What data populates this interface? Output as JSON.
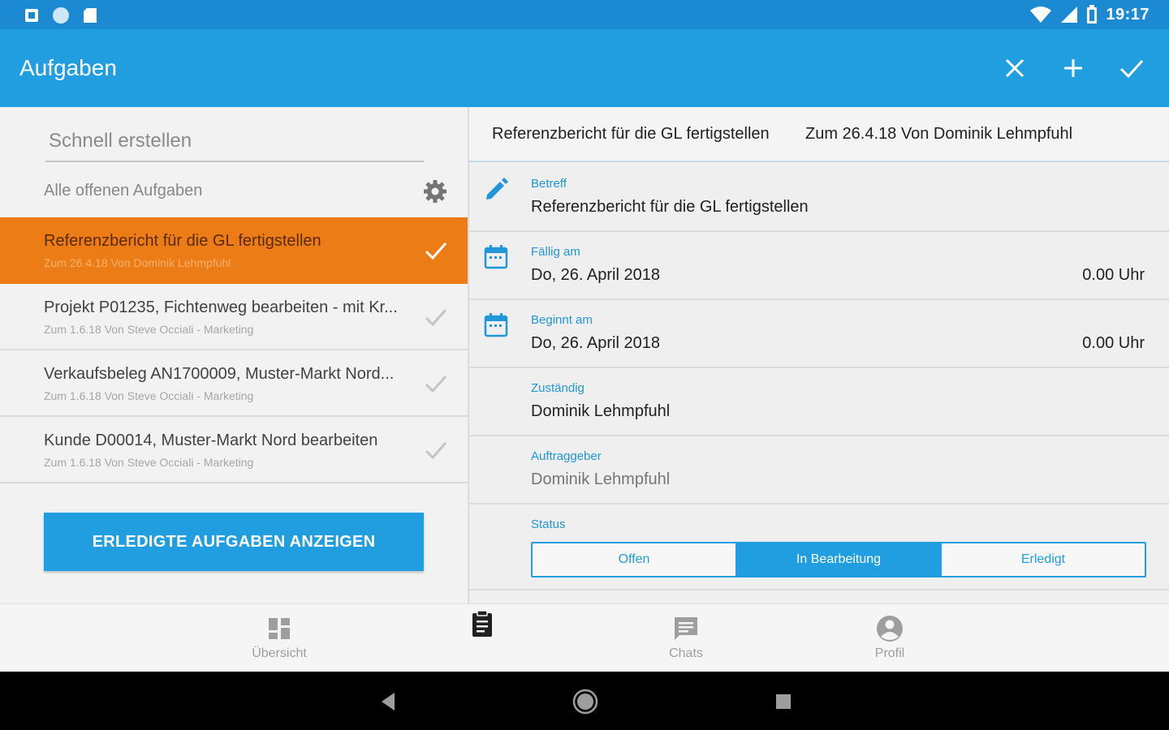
{
  "status_bar": {
    "time": "19:17",
    "left_icons": [
      "notification-icon",
      "circle-status-icon",
      "sd-card-icon"
    ],
    "right_icons": [
      "wifi-icon",
      "cell-signal-icon",
      "battery-icon"
    ]
  },
  "app_bar": {
    "title": "Aufgaben",
    "actions": [
      "close-icon",
      "add-icon",
      "check-icon"
    ]
  },
  "left_pane": {
    "quick_create_placeholder": "Schnell erstellen",
    "filter_label": "Alle offenen Aufgaben",
    "tasks": [
      {
        "title": "Referenzbericht für die GL fertigstellen",
        "subtitle": "Zum 26.4.18 Von Dominik Lehmpfuhl",
        "active": true
      },
      {
        "title": "Projekt P01235, Fichtenweg bearbeiten - mit Kr...",
        "subtitle": "Zum 1.6.18 Von Steve Occiali - Marketing",
        "active": false
      },
      {
        "title": "Verkaufsbeleg AN1700009, Muster-Markt Nord...",
        "subtitle": "Zum 1.6.18 Von Steve Occiali - Marketing",
        "active": false
      },
      {
        "title": "Kunde D00014, Muster-Markt Nord bearbeiten",
        "subtitle": "Zum 1.6.18 Von Steve Occiali - Marketing",
        "active": false
      }
    ],
    "show_done_button": "ERLEDIGTE AUFGABEN ANZEIGEN"
  },
  "detail": {
    "header_title": "Referenzbericht für die GL fertigstellen",
    "header_meta": "Zum 26.4.18 Von Dominik Lehmpfuhl",
    "betreff": {
      "label": "Betreff",
      "value": "Referenzbericht für die GL fertigstellen"
    },
    "faellig": {
      "label": "Fällig am",
      "value": "Do, 26. April 2018",
      "time": "0.00 Uhr"
    },
    "beginnt": {
      "label": "Beginnt am",
      "value": "Do, 26. April 2018",
      "time": "0.00 Uhr"
    },
    "zustaendig": {
      "label": "Zuständig",
      "value": "Dominik Lehmpfuhl"
    },
    "auftraggeber": {
      "label": "Auftraggeber",
      "value": "Dominik Lehmpfuhl"
    },
    "status": {
      "label": "Status",
      "options": [
        "Offen",
        "In Bearbeitung",
        "Erledigt"
      ],
      "selected": "In Bearbeitung"
    }
  },
  "bottom_nav": {
    "items": [
      {
        "label": "Übersicht",
        "icon": "dashboard-icon"
      },
      {
        "label": "",
        "icon": "clipboard-icon"
      },
      {
        "label": "Chats",
        "icon": "chat-icon"
      },
      {
        "label": "Profil",
        "icon": "account-icon"
      }
    ]
  },
  "colors": {
    "app_bar": "#209ee0",
    "status_bar": "#1b8ad3",
    "active_task": "#ec7c16",
    "accent_label": "#2196d8"
  }
}
